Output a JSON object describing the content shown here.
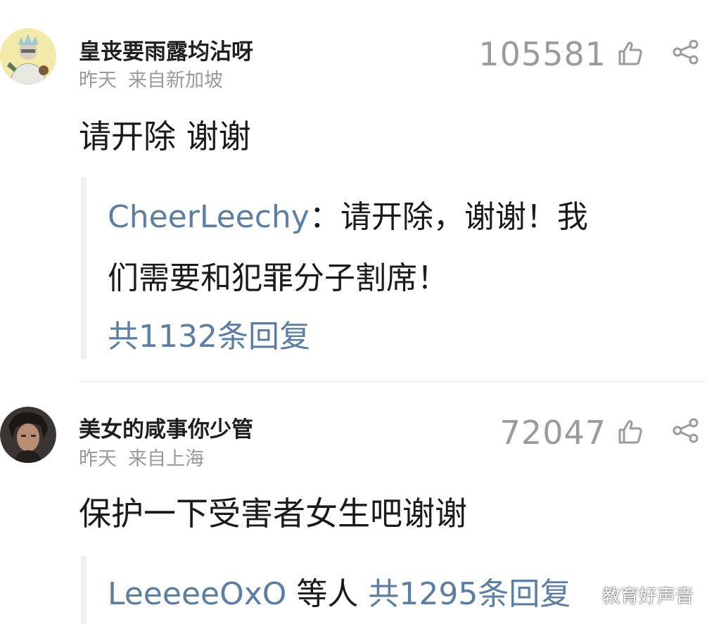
{
  "comments": [
    {
      "username": "皇丧要雨露均沾呀",
      "time": "昨天",
      "location": "来自新加坡",
      "likes": "105581",
      "content": "请开除 谢谢",
      "reply": {
        "author": "CheerLeechy",
        "line1_text": "：请开除，谢谢！我",
        "line2_text": "们需要和犯罪分子割席！",
        "count_label": "共1132条回复"
      }
    },
    {
      "username": "美女的咸事你少管",
      "time": "昨天",
      "location": "来自上海",
      "likes": "72047",
      "content": "保护一下受害者女生吧谢谢",
      "reply": {
        "author": "LeeeeeOxO",
        "others_label": "等人",
        "count_label": "共1295条回复"
      }
    }
  ],
  "icons": {
    "like": "thumbs-up-icon",
    "share": "share-icon"
  },
  "watermark": {
    "text": "教育好声音",
    "icon": "wechat-icon"
  },
  "colors": {
    "link_blue": "#5a7ea5",
    "meta_gray": "#9a9a9a",
    "quote_bar": "#f0f0f0"
  }
}
